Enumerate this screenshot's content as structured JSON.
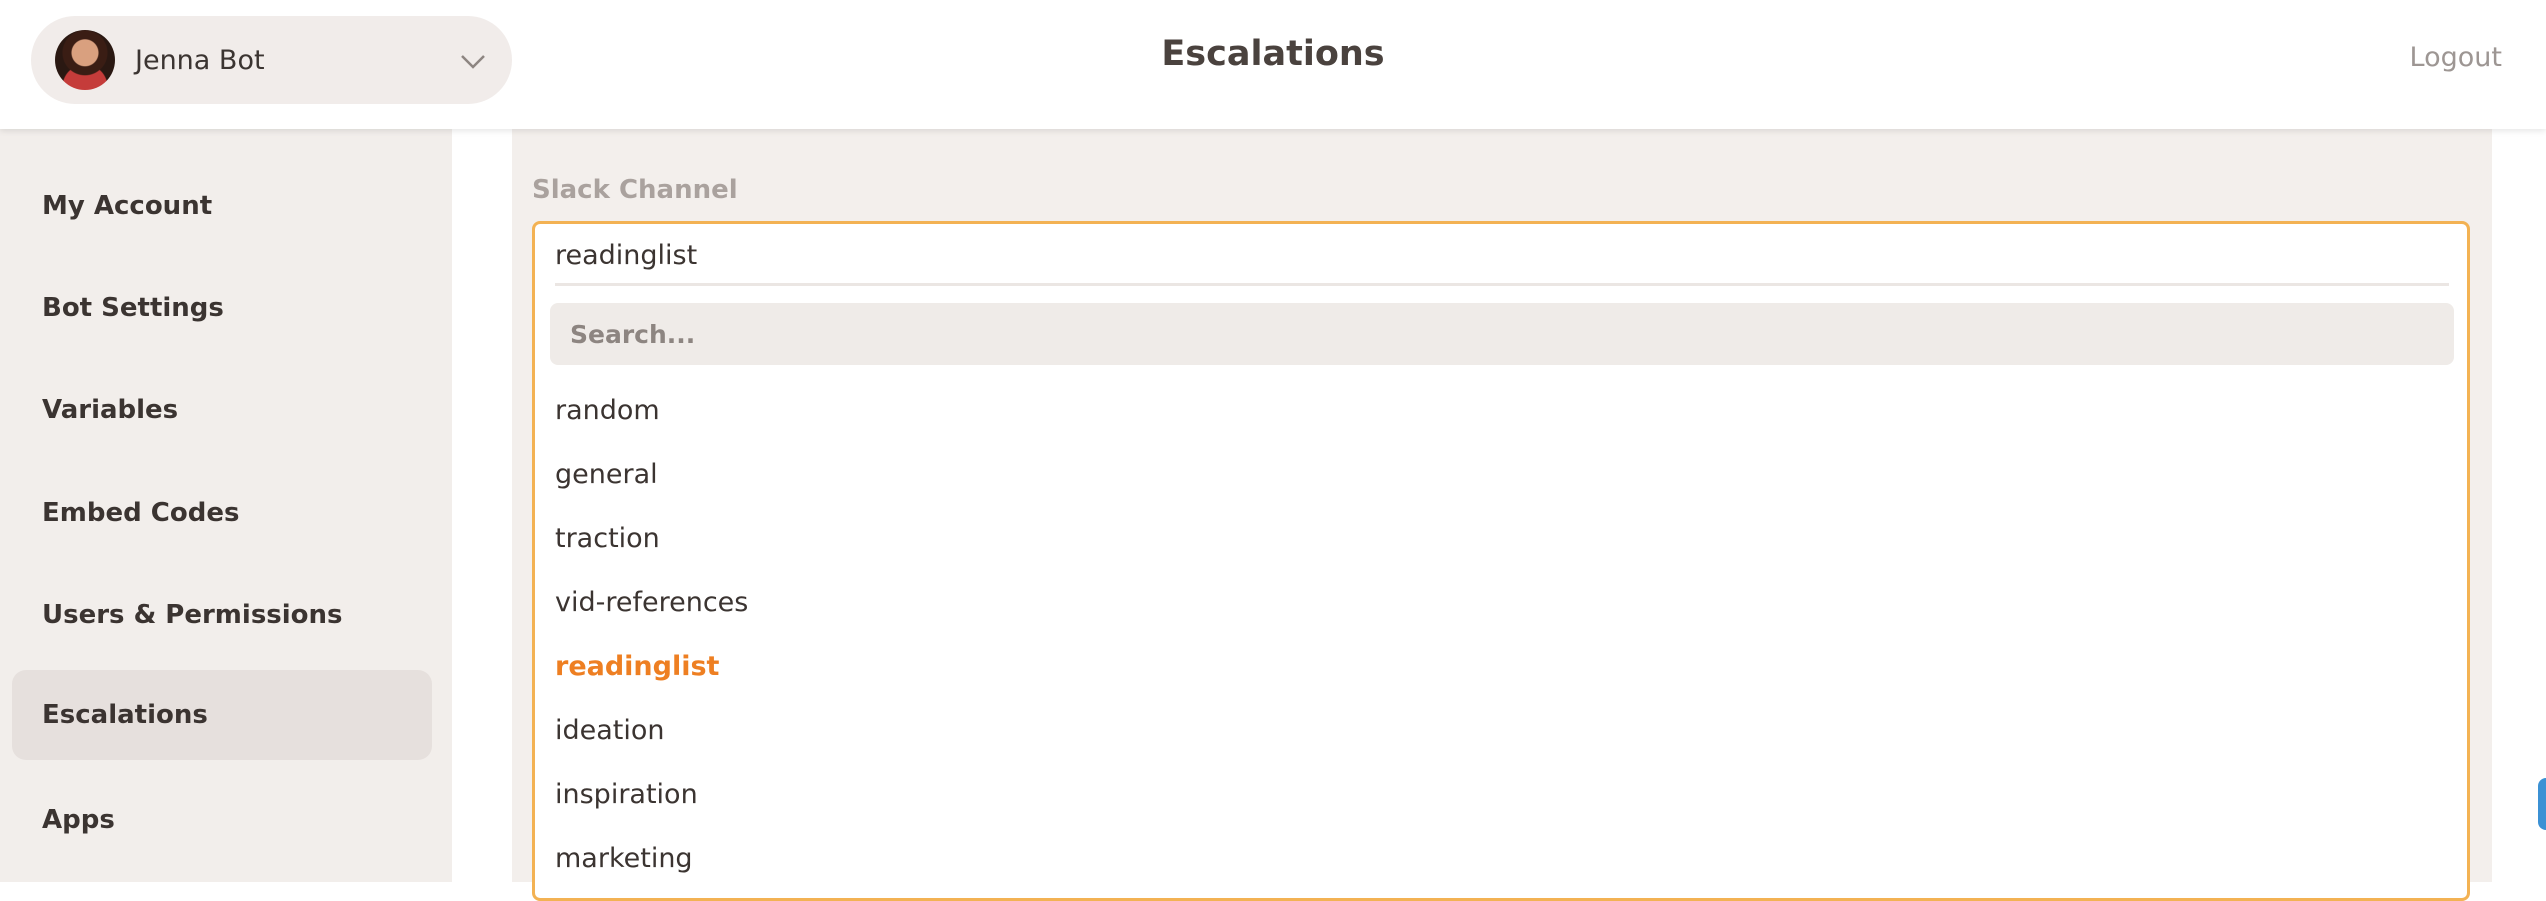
{
  "header": {
    "account_name": "Jenna Bot",
    "page_title": "Escalations",
    "logout_label": "Logout"
  },
  "sidebar": {
    "items": [
      {
        "label": "My Account",
        "active": false
      },
      {
        "label": "Bot Settings",
        "active": false
      },
      {
        "label": "Variables",
        "active": false
      },
      {
        "label": "Embed Codes",
        "active": false
      },
      {
        "label": "Users & Permissions",
        "active": false
      },
      {
        "label": "Escalations",
        "active": true
      },
      {
        "label": "Apps",
        "active": false
      }
    ]
  },
  "form": {
    "slack_channel_label": "Slack Channel",
    "selected_value": "readinglist",
    "search_placeholder": "Search...",
    "options": [
      {
        "label": "random",
        "selected": false
      },
      {
        "label": "general",
        "selected": false
      },
      {
        "label": "traction",
        "selected": false
      },
      {
        "label": "vid-references",
        "selected": false
      },
      {
        "label": "readinglist",
        "selected": true
      },
      {
        "label": "ideation",
        "selected": false
      },
      {
        "label": "inspiration",
        "selected": false
      },
      {
        "label": "marketing",
        "selected": false
      }
    ]
  },
  "colors": {
    "accent": "#ee7f22",
    "focus_border": "#f3b253",
    "sidebar_bg": "#f2eeeb",
    "active_item_bg": "#e6e0dd"
  },
  "icons": {
    "avatar": "user-avatar-photo",
    "chevron": "chevron-down-icon"
  }
}
